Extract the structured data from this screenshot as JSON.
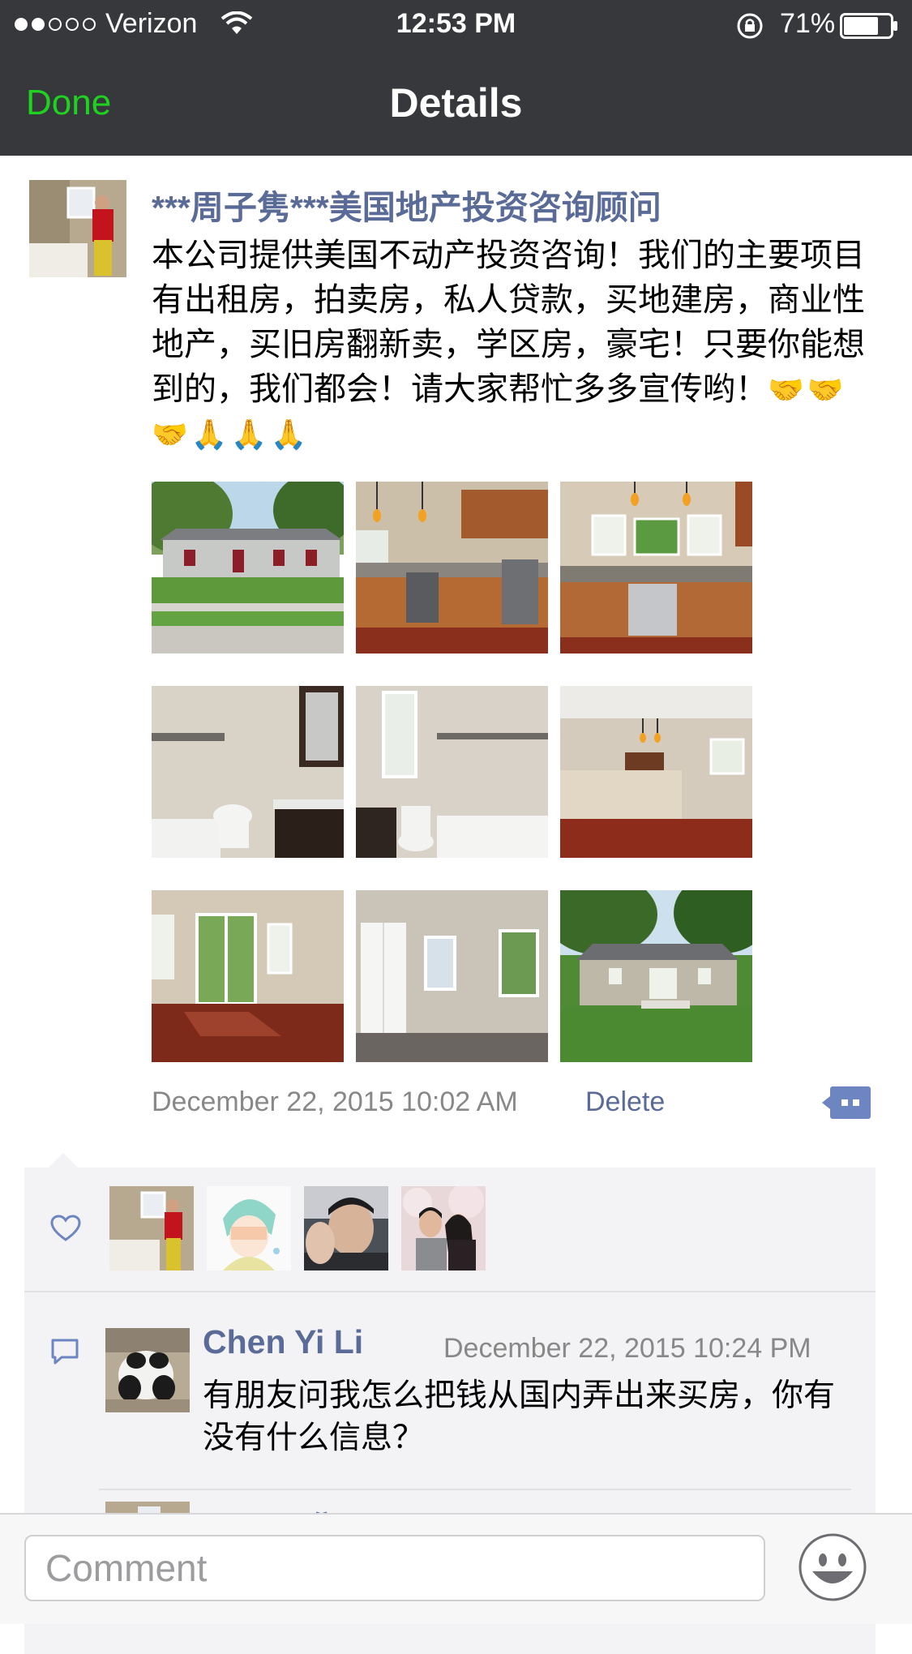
{
  "status_bar": {
    "carrier": "Verizon",
    "time": "12:53 PM",
    "battery": "71%"
  },
  "nav": {
    "done_label": "Done",
    "title": "Details"
  },
  "post": {
    "author": "***周子隽***美国地产投资咨询顾问",
    "body": "本公司提供美国不动产投资咨询！我们的主要项目有出租房，拍卖房，私人贷款，买地建房，商业性地产，买旧房翻新卖，学区房，豪宅！只要你能想到的，我们都会！请大家帮忙多多宣传哟！",
    "body_emoji": "🤝🤝🤝🙏🙏🙏",
    "photos": [
      "house-front-photo",
      "kitchen-photo",
      "kitchen-window-photo",
      "bathroom-vanity-photo",
      "bathroom-tub-photo",
      "open-living-kitchen-photo",
      "living-room-photo",
      "bedroom-photo",
      "house-back-photo"
    ],
    "timestamp": "December 22, 2015 10:02 AM",
    "delete_label": "Delete"
  },
  "likes": {
    "avatars": [
      "liker-avatar-1",
      "liker-avatar-2",
      "liker-avatar-3",
      "liker-avatar-4"
    ]
  },
  "comments": [
    {
      "author": "Chen Yi Li",
      "time": "December 22, 2015 10:24 PM",
      "text": "有朋友问我怎么把钱从国内弄出来买房，你有没有什么信息？"
    },
    {
      "author": "***周子隽**"
    }
  ],
  "comment_bar": {
    "placeholder": "Comment"
  },
  "colors": {
    "nav_background": "#36383c",
    "done_green": "#1fd21f",
    "link_blue": "#5a6b98",
    "panel_background": "#f3f3f5"
  }
}
